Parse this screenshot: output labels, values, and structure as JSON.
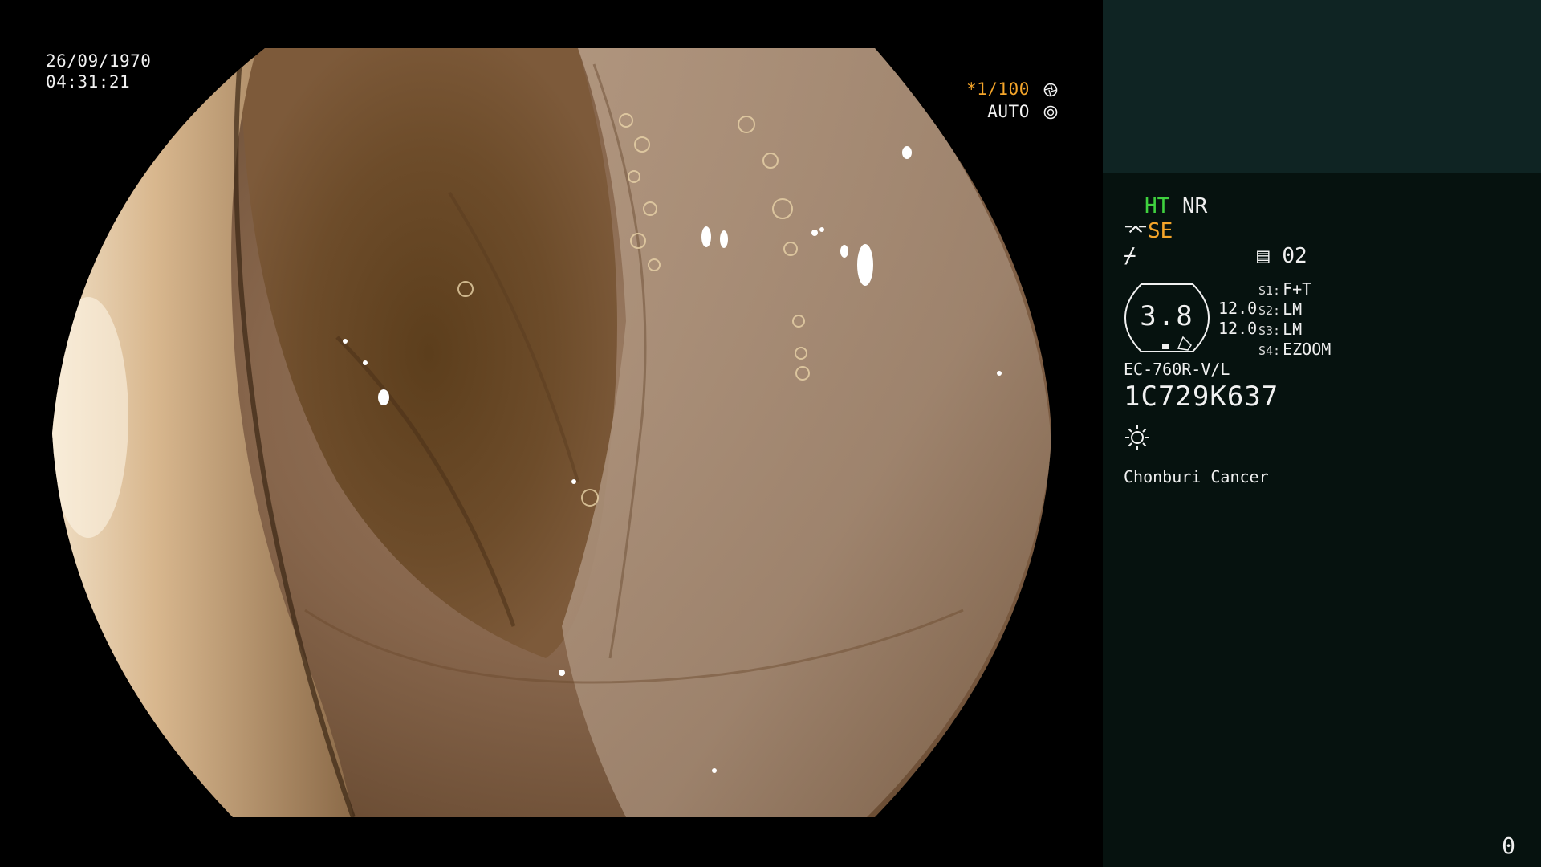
{
  "overlay": {
    "date": "26/09/1970",
    "time": "04:31:21",
    "shutter": "*1/100",
    "shutter_icon": "aperture-icon",
    "exposure": "AUTO",
    "exposure_icon": "iris-icon"
  },
  "panel": {
    "mode_ht": "HT",
    "mode_nr": "NR",
    "se_label": "SE",
    "se_icon": "structure-enhance-icon",
    "bend_icon": "bend-icon",
    "memo_icon": "memo-icon",
    "memo_value": "02",
    "zoom_value": "3.8",
    "level_1": "12.0",
    "level_2": "12.0",
    "switches": [
      {
        "key": "S1:",
        "value": "F+T"
      },
      {
        "key": "S2:",
        "value": "LM"
      },
      {
        "key": "S3:",
        "value": "LM"
      },
      {
        "key": "S4:",
        "value": "EZOOM"
      }
    ],
    "scope_model": "EC-760R-V/L",
    "serial": "1C729K637",
    "light_icon": "light-source-icon",
    "hospital": "Chonburi Cancer",
    "counter": "0"
  },
  "colors": {
    "panel_bg": "#06120f",
    "panel_header": "#0f2423",
    "ht_green": "#3fd13f",
    "accent_orange": "#f4a52a"
  }
}
